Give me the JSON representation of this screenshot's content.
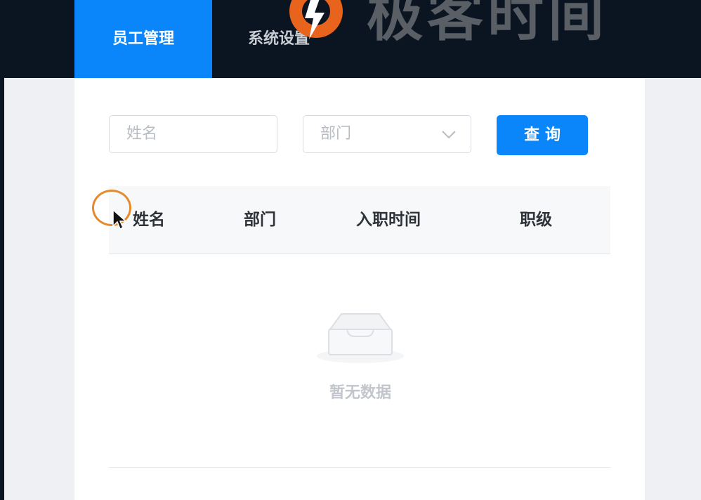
{
  "header": {
    "tabs": [
      {
        "label": "员工管理",
        "active": true
      },
      {
        "label": "系统设置",
        "active": false
      }
    ],
    "brand_text": "极客时间"
  },
  "filters": {
    "name_placeholder": "姓名",
    "department_placeholder": "部门",
    "search_label": "查询"
  },
  "table": {
    "columns": [
      "姓名",
      "部门",
      "入职时间",
      "职级"
    ],
    "rows": [],
    "empty_text": "暂无数据"
  },
  "colors": {
    "primary": "#0b86fa",
    "header_bg": "#0b1522",
    "brand_orange": "#e8631c"
  }
}
